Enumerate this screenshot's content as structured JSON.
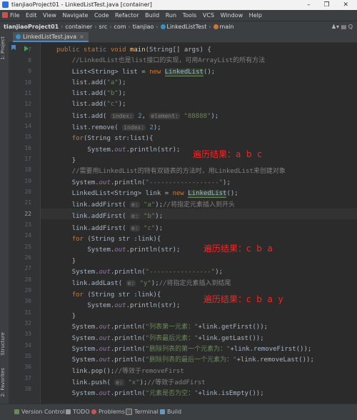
{
  "window": {
    "title": "tianjiaoProject01 - LinkedListTest.java [container]",
    "controls": "– ❐ ✕"
  },
  "menu": [
    "File",
    "Edit",
    "View",
    "Navigate",
    "Code",
    "Refactor",
    "Build",
    "Run",
    "Tools",
    "VCS",
    "Window",
    "Help"
  ],
  "breadcrumb": {
    "project": "tianjiaoProject01",
    "module": "container",
    "src": "src",
    "pkg1": "com",
    "pkg2": "tianjiao",
    "cls": "LinkedListTest",
    "method": "main"
  },
  "navbar_right": "♟▾  ▤  Q",
  "tab": {
    "label": "LinkedListTest.java",
    "close": "×"
  },
  "tools": {
    "project": "1: Project",
    "structure": "Structure",
    "favorites": "2: Favorites"
  },
  "line_numbers": [
    "7",
    "8",
    "9",
    "10",
    "11",
    "12",
    "13",
    "14",
    "15",
    "16",
    "17",
    "18",
    "19",
    "20",
    "21",
    "22",
    "23",
    "24",
    "25",
    "26",
    "27",
    "28",
    "29",
    "30",
    "31",
    "32",
    "33",
    "34",
    "35",
    "36",
    "37",
    "38"
  ],
  "current_line": "22",
  "code": {
    "l7_a": "public static void ",
    "l7_b": "main",
    "l7_c": "(String[] args) {",
    "l8": "//LinkedList也是list接口的实现，可用ArrayList的所有方法",
    "l9_a": "List<String> list = ",
    "l9_b": "new ",
    "l9_c": "LinkedList",
    "l9_d": "();",
    "l10_a": "list.add(",
    "l10_b": "\"a\"",
    "l10_c": ");",
    "l11_a": "list.add(",
    "l11_b": "\"b\"",
    "l11_c": ");",
    "l12_a": "list.add(",
    "l12_b": "\"c\"",
    "l12_c": ");",
    "l13_a": "list.add( ",
    "l13_h1": "index:",
    "l13_b": " 2",
    "l13_c": ", ",
    "l13_h2": "element:",
    "l13_d": " \"88888\"",
    "l13_e": ");",
    "l14_a": "list.remove( ",
    "l14_h": "index:",
    "l14_b": " 2",
    "l14_c": ");",
    "l15_a": "for",
    "l15_b": "(String str:list){",
    "l16_a": "    System.",
    "l16_b": "out",
    "l16_c": ".println(str);",
    "l17": "}",
    "l18": "//需要用LinkedList的特有双链表的方法时，用LinkedList来创建对象",
    "l19_a": "System.",
    "l19_b": "out",
    "l19_c": ".println(",
    "l19_d": "\"------------------\"",
    "l19_e": ");",
    "l20_a": "LinkedList<String> link = ",
    "l20_b": "new ",
    "l20_c": "LinkedList",
    "l20_d": "();",
    "l21_a": "link.addFirst( ",
    "l21_h": "e:",
    "l21_b": " \"a\"",
    "l21_c": ");",
    "l21_d": "//将指定元素插入到开头",
    "l22_a": "link.addFirst( ",
    "l22_h": "e:",
    "l22_b": " \"b\"",
    "l22_c": ");",
    "l23_a": "link.addFirst( ",
    "l23_h": "e:",
    "l23_b": " \"c\"",
    "l23_c": ");",
    "l24_a": "for ",
    "l24_b": "(String str :link){",
    "l25_a": "    System.",
    "l25_b": "out",
    "l25_c": ".println(str);",
    "l26": "}",
    "l27_a": "System.",
    "l27_b": "out",
    "l27_c": ".println(",
    "l27_d": "\"----------------\"",
    "l27_e": ");",
    "l28_a": "link.addLast( ",
    "l28_h": "e:",
    "l28_b": " \"y\"",
    "l28_c": ");",
    "l28_d": "//将指定元素插入到结尾",
    "l29_a": "for ",
    "l29_b": "(String str :link){",
    "l30_a": "    System.",
    "l30_b": "out",
    "l30_c": ".println(str);",
    "l31": "}",
    "l32_a": "System.",
    "l32_b": "out",
    "l32_c": ".println(",
    "l32_d": "\"列表第一元素：\"",
    "l32_e": "+link.getFirst());",
    "l33_a": "System.",
    "l33_b": "out",
    "l33_c": ".println(",
    "l33_d": "\"列表最后元素：\"",
    "l33_e": "+link.getLast());",
    "l34_a": "System.",
    "l34_b": "out",
    "l34_c": ".println(",
    "l34_d": "\"删除列表的第一个元素为：\"",
    "l34_e": "+link.removeFirst());",
    "l35_a": "System.",
    "l35_b": "out",
    "l35_c": ".println(",
    "l35_d": "\"删除列表的最后一个元素为：\"",
    "l35_e": "+link.removeLast());",
    "l36_a": "link.pop();",
    "l36_b": "//等效于removeFirst",
    "l37_a": "link.push( ",
    "l37_h": "e:",
    "l37_b": " \"x\"",
    "l37_c": ");",
    "l37_d": "//等效于addFirst",
    "l38_a": "System.",
    "l38_b": "out",
    "l38_c": ".println(",
    "l38_d": "\"元素是否为空：\"",
    "l38_e": "+link.isEmpty());"
  },
  "annotations": {
    "a1": "遍历结果：a  b  c",
    "a2": "遍历结果：c  b  a",
    "a3": "遍历结果：c  b  a  y"
  },
  "status": {
    "vc": "Version Control",
    "todo": "TODO",
    "problems": "Problems",
    "terminal": "Terminal",
    "build": "Build"
  },
  "colors": {
    "keyword": "#cc7832",
    "string": "#6a8759",
    "comment": "#808080",
    "annotation": "#ff2222"
  }
}
